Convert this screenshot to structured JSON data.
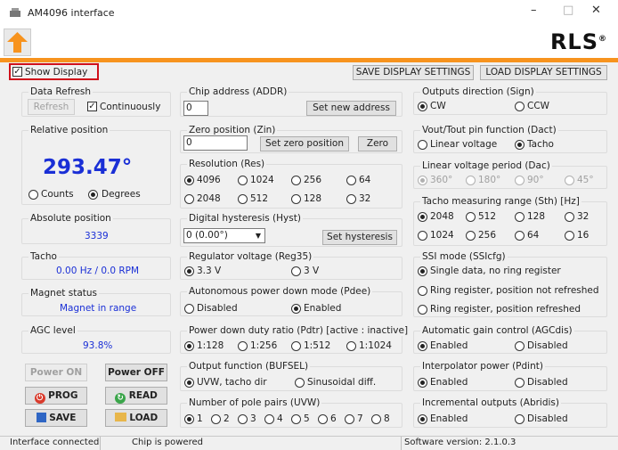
{
  "window": {
    "title": "AM4096 interface",
    "logo": "RLS",
    "minimize": "–",
    "maximize": "□",
    "close": "✕"
  },
  "toolbar": {
    "show_display": "Show Display",
    "save_display": "SAVE DISPLAY SETTINGS",
    "load_display": "LOAD DISPLAY SETTINGS"
  },
  "left": {
    "data_refresh": {
      "title": "Data Refresh",
      "refresh": "Refresh",
      "continuously": "Continuously"
    },
    "relative_position": {
      "title": "Relative position",
      "value": "293.47°",
      "counts": "Counts",
      "degrees": "Degrees"
    },
    "absolute_position": {
      "title": "Absolute position",
      "value": "3339"
    },
    "tacho": {
      "title": "Tacho",
      "value": "0.00 Hz / 0.0 RPM"
    },
    "magnet_status": {
      "title": "Magnet status",
      "value": "Magnet in range"
    },
    "agc_level": {
      "title": "AGC level",
      "value": "93.8%"
    },
    "buttons": {
      "power_on": "Power ON",
      "power_off": "Power OFF",
      "prog": "PROG",
      "read": "READ",
      "save": "SAVE",
      "load": "LOAD"
    }
  },
  "middle": {
    "chip_address": {
      "title": "Chip address  (ADDR)",
      "value": "0",
      "button": "Set new address"
    },
    "zero_position": {
      "title": "Zero position  (Zin)",
      "value": "0",
      "button": "Set zero position",
      "zero": "Zero"
    },
    "resolution": {
      "title": "Resolution (Res)",
      "options": [
        "4096",
        "1024",
        "256",
        "64",
        "2048",
        "512",
        "128",
        "32"
      ],
      "selected": 0
    },
    "hysteresis": {
      "title": "Digital hysteresis (Hyst)",
      "value": "0 (0.00°)",
      "button": "Set hysteresis"
    },
    "regulator": {
      "title": "Regulator voltage (Reg35)",
      "options": [
        "3.3 V",
        "3 V"
      ],
      "selected": 0
    },
    "pdee": {
      "title": "Autonomous power down mode (Pdee)",
      "options": [
        "Disabled",
        "Enabled"
      ],
      "selected": 1
    },
    "pdtr": {
      "title": "Power down duty ratio (Pdtr) [active : inactive]",
      "options": [
        "1:128",
        "1:256",
        "1:512",
        "1:1024"
      ],
      "selected": 0
    },
    "bufsel": {
      "title": "Output function (BUFSEL)",
      "options": [
        "UVW, tacho dir",
        "Sinusoidal diff."
      ],
      "selected": 0
    },
    "pole_pairs": {
      "title": "Number of pole pairs (UVW)",
      "options": [
        "1",
        "2",
        "3",
        "4",
        "5",
        "6",
        "7",
        "8"
      ],
      "selected": 0
    }
  },
  "right": {
    "sign": {
      "title": "Outputs direction (Sign)",
      "options": [
        "CW",
        "CCW"
      ],
      "selected": 0
    },
    "dact": {
      "title": "Vout/Tout pin function (Dact)",
      "options": [
        "Linear voltage",
        "Tacho"
      ],
      "selected": 1
    },
    "dac": {
      "title": "Linear voltage period (Dac)",
      "options": [
        "360°",
        "180°",
        "90°",
        "45°"
      ],
      "selected": 0
    },
    "sth": {
      "title": "Tacho measuring range (Sth) [Hz]",
      "options": [
        "2048",
        "512",
        "128",
        "32",
        "1024",
        "256",
        "64",
        "16"
      ],
      "selected": 0
    },
    "ssi": {
      "title": "SSI mode (SSIcfg)",
      "options": [
        "Single data, no ring register",
        "Ring register, position not refreshed",
        "Ring register, position refreshed"
      ],
      "selected": 0
    },
    "agcdis": {
      "title": "Automatic gain control (AGCdis)",
      "options": [
        "Enabled",
        "Disabled"
      ],
      "selected": 0
    },
    "pdint": {
      "title": "Interpolator power (Pdint)",
      "options": [
        "Enabled",
        "Disabled"
      ],
      "selected": 0
    },
    "abridis": {
      "title": "Incremental outputs (Abridis)",
      "options": [
        "Enabled",
        "Disabled"
      ],
      "selected": 0
    }
  },
  "status": {
    "connection": "Interface connected",
    "chip": "Chip is powered",
    "version": "Software version: 2.1.0.3"
  },
  "colors": {
    "accent": "#f7931e",
    "value_blue": "#1a2fd6",
    "highlight_red": "#d0101a"
  }
}
